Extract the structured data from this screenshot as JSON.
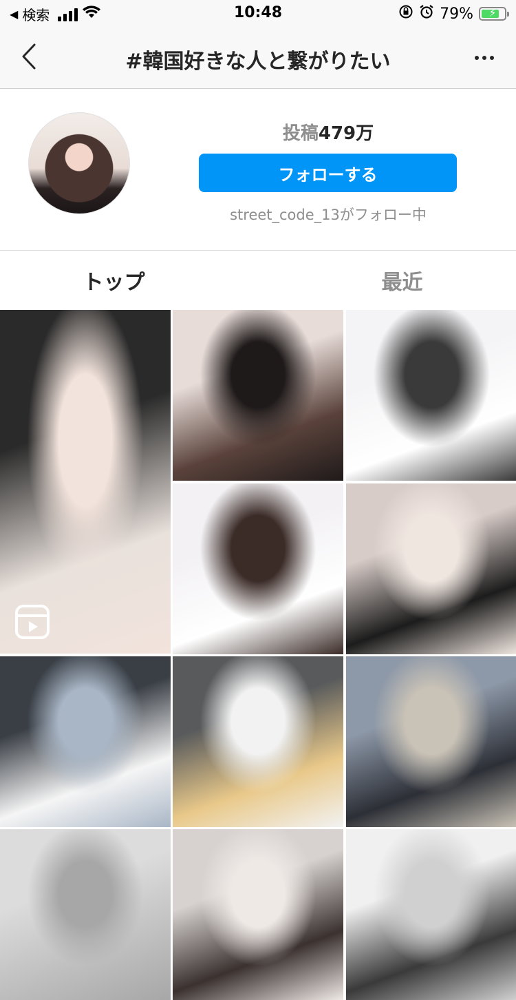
{
  "status_bar": {
    "back_label": "検索",
    "time": "10:48",
    "battery": "79%",
    "battery_level": 0.79,
    "icons": [
      "back-arrow-icon",
      "signal-icon",
      "wifi-icon",
      "orientation-lock-icon",
      "alarm-icon",
      "battery-icon"
    ]
  },
  "header": {
    "title": "#韓国好きな人と繋がりたい",
    "back_icon": "chevron-left-icon",
    "more_icon": "more-horizontal-icon"
  },
  "profile": {
    "posts_label": "投稿",
    "posts_count": "479万",
    "follow_button": "フォローする",
    "followed_by": "street_code_13がフォロー中"
  },
  "tabs": [
    {
      "label": "トップ",
      "active": true
    },
    {
      "label": "最近",
      "active": false
    }
  ],
  "grid": {
    "tiles": [
      {
        "name": "post-boy-portrait",
        "reel": true,
        "colors": [
          "#2a2a2a",
          "#e9e1dc",
          "#f2e3dc"
        ]
      },
      {
        "name": "post-girl-selfie",
        "reel": false,
        "colors": [
          "#e7dcd8",
          "#5a423b",
          "#1f1a1a"
        ]
      },
      {
        "name": "post-two-girls-uniform",
        "reel": false,
        "colors": [
          "#f4f4f6",
          "#ffffff",
          "#3a3a3a"
        ]
      },
      {
        "name": "post-two-girls-white",
        "reel": false,
        "colors": [
          "#f3f1f4",
          "#ffffff",
          "#3b2c28"
        ]
      },
      {
        "name": "post-friends-hands",
        "reel": false,
        "colors": [
          "#d8ccc8",
          "#1c1c1c",
          "#f0e6e0"
        ]
      },
      {
        "name": "post-boy-sitting",
        "reel": false,
        "colors": [
          "#3a3f46",
          "#f5f5f5",
          "#a9b6c6"
        ]
      },
      {
        "name": "post-blonde-girl-car",
        "reel": false,
        "colors": [
          "#585a5c",
          "#e9c98a",
          "#f2f2f2"
        ]
      },
      {
        "name": "post-girls-beach",
        "reel": false,
        "colors": [
          "#8d98a8",
          "#2c2f36",
          "#c9c2b6"
        ]
      },
      {
        "name": "post-partial-1",
        "reel": false,
        "colors": [
          "#dcdcdc",
          "#bfbfbf",
          "#a7a7a7"
        ]
      },
      {
        "name": "post-partial-2",
        "reel": false,
        "colors": [
          "#d7d2cf",
          "#3b3230",
          "#efe9e6"
        ]
      },
      {
        "name": "post-partial-3",
        "reel": false,
        "colors": [
          "#f0f0f0",
          "#3a3a3a",
          "#d0d0d0"
        ]
      }
    ]
  },
  "colors": {
    "primary_blue": "#0095f6",
    "muted_text": "#8e8e8e",
    "text": "#262626"
  }
}
